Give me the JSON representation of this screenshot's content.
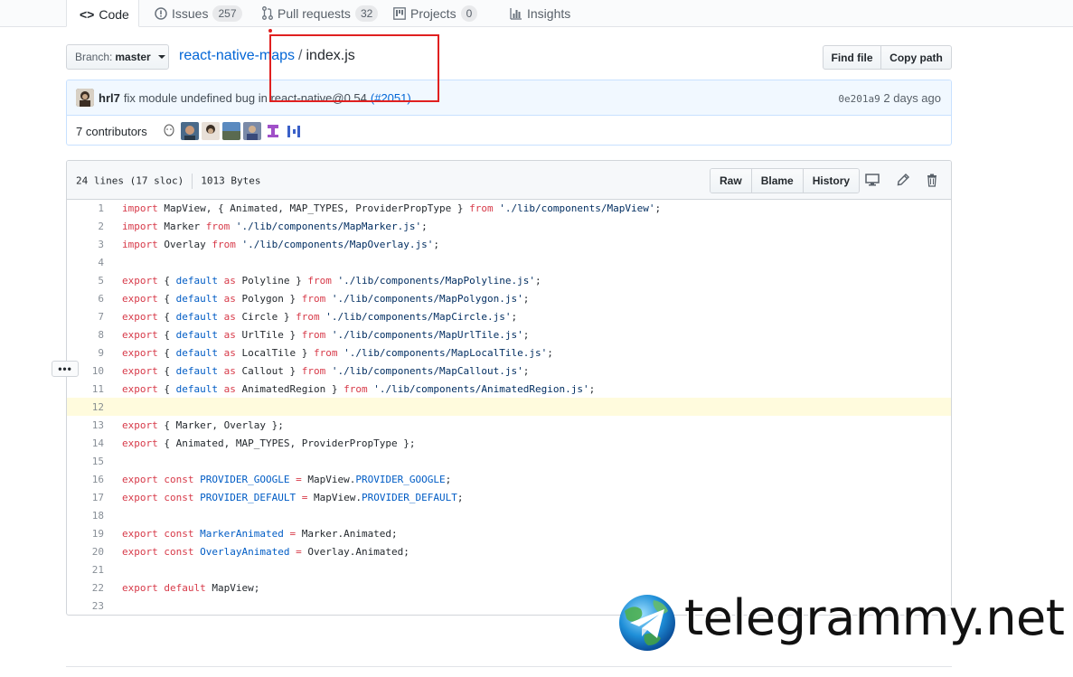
{
  "nav": {
    "tabs": [
      {
        "label": "Code",
        "icon": "code-icon",
        "count": ""
      },
      {
        "label": "Issues",
        "icon": "issue-opened-icon",
        "count": "257"
      },
      {
        "label": "Pull requests",
        "icon": "git-pull-request-icon",
        "count": "32"
      },
      {
        "label": "Projects",
        "icon": "project-icon",
        "count": "0"
      },
      {
        "label": "Insights",
        "icon": "graph-icon",
        "count": ""
      }
    ]
  },
  "branch": {
    "label": "Branch:",
    "value": "master"
  },
  "breadcrumb": {
    "repo": "react-native-maps",
    "separator": "/",
    "file": "index.js"
  },
  "actions": {
    "find_file": "Find file",
    "copy_path": "Copy path"
  },
  "commit": {
    "author": "hrl7",
    "message": "fix module undefined bug in react-native@0.54",
    "pr_link": "(#2051)",
    "sha": "0e201a9",
    "time": "2 days ago"
  },
  "contributors": {
    "label": "7 contributors"
  },
  "file": {
    "lines_info": "24 lines (17 sloc)",
    "size": "1013 Bytes",
    "raw": "Raw",
    "blame": "Blame",
    "history": "History"
  },
  "code": [
    "import MapView, { Animated, MAP_TYPES, ProviderPropType } from './lib/components/MapView';",
    "import Marker from './lib/components/MapMarker.js';",
    "import Overlay from './lib/components/MapOverlay.js';",
    "",
    "export { default as Polyline } from './lib/components/MapPolyline.js';",
    "export { default as Polygon } from './lib/components/MapPolygon.js';",
    "export { default as Circle } from './lib/components/MapCircle.js';",
    "export { default as UrlTile } from './lib/components/MapUrlTile.js';",
    "export { default as LocalTile } from './lib/components/MapLocalTile.js';",
    "export { default as Callout } from './lib/components/MapCallout.js';",
    "export { default as AnimatedRegion } from './lib/components/AnimatedRegion.js';",
    "",
    "export { Marker, Overlay };",
    "export { Animated, MAP_TYPES, ProviderPropType };",
    "",
    "export const PROVIDER_GOOGLE = MapView.PROVIDER_GOOGLE;",
    "export const PROVIDER_DEFAULT = MapView.PROVIDER_DEFAULT;",
    "",
    "export const MarkerAnimated = Marker.Animated;",
    "export const OverlayAnimated = Overlay.Animated;",
    "",
    "export default MapView;",
    ""
  ],
  "highlighted_line": 12,
  "watermark": {
    "text": "telegrammy.net"
  },
  "colors": {
    "link": "#0366d6",
    "keyword": "#d73a49",
    "constant": "#005cc5",
    "string": "#032f62",
    "annotation": "#e02020",
    "highlight": "#fffbdd"
  }
}
